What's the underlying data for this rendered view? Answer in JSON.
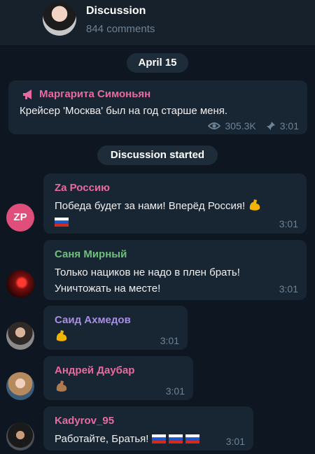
{
  "header": {
    "title": "Discussion",
    "subtitle": "844 comments"
  },
  "date_chip": "April 15",
  "channel_post": {
    "name": "Маргарита Симоньян",
    "text": "Крейсер 'Москва' был на год старше меня.",
    "views": "305.3K",
    "time": "3:01"
  },
  "discussion_chip": "Discussion started",
  "colors": {
    "background": "#0e1621",
    "bubble": "#182533",
    "channel_name": "#e76ba0",
    "meta": "#6f8396"
  },
  "messages": [
    {
      "sender": "Zа Россию",
      "sender_color": "#e76ba0",
      "avatar_initials": "ZP",
      "line1": "Победа будет за нами! Вперёд Россия!",
      "time": "3:01",
      "icons": [
        "flexed-biceps-emoji",
        "russia-flag-emoji"
      ]
    },
    {
      "sender": "Саня Мирный",
      "sender_color": "#6ec07a",
      "line1": "Только нациков не надо в плен брать!",
      "line2": "Уничтожать на месте!",
      "time": "3:01"
    },
    {
      "sender": "Саид Ахмедов",
      "sender_color": "#a98ee6",
      "time": "3:01",
      "icons": [
        "flexed-biceps-emoji"
      ]
    },
    {
      "sender": "Андрей Даубар",
      "sender_color": "#e76ba0",
      "time": "3:01",
      "icons": [
        "flexed-biceps-medium-skin-emoji"
      ]
    },
    {
      "sender": "Kadyrov_95",
      "sender_color": "#e76ba0",
      "line1": "Работайте, Братья!",
      "time": "3:01",
      "icons": [
        "russia-flag-emoji",
        "russia-flag-emoji",
        "russia-flag-emoji"
      ]
    }
  ]
}
